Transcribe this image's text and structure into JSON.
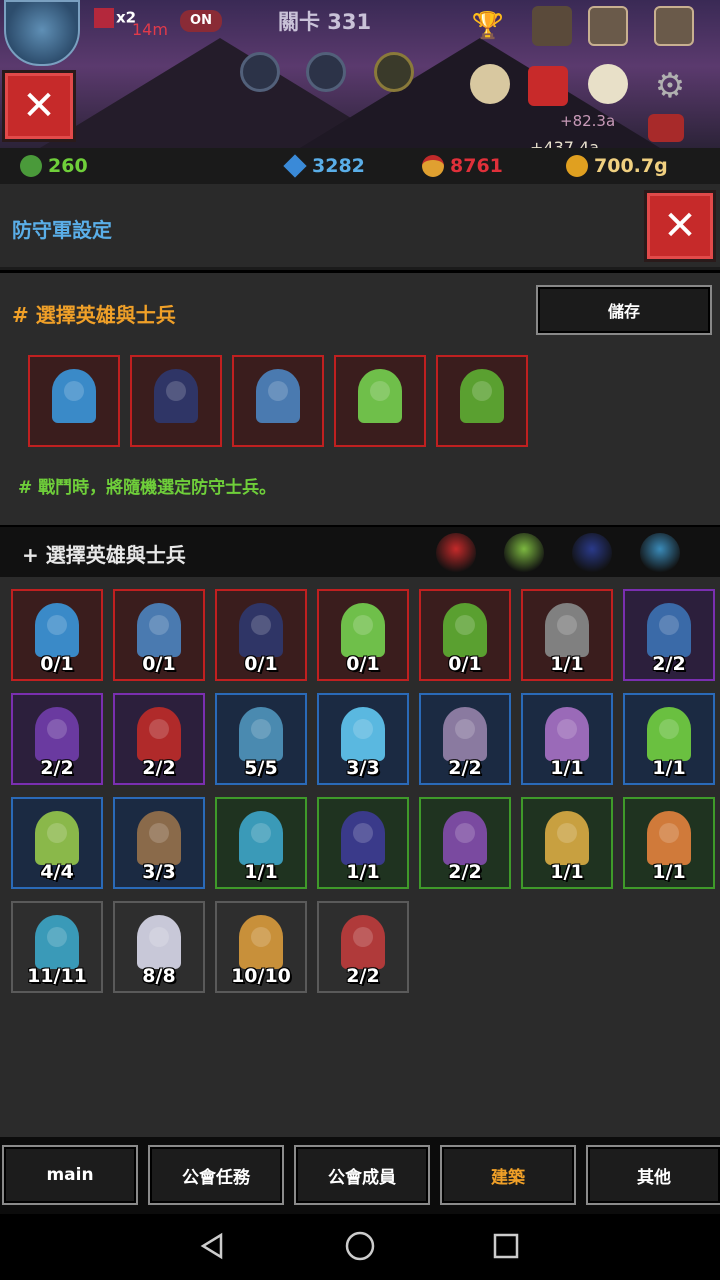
{
  "scene": {
    "speed_label": "x2",
    "timer": "14m",
    "toggle_label": "ON",
    "stage": "關卡 331",
    "floating_gain_1": "+82.3a",
    "floating_gain_2": "+437.4a"
  },
  "resources": {
    "gems_green": "260",
    "diamonds": "3282",
    "medals": "8761",
    "gold": "700.7g"
  },
  "panel": {
    "title": "防守軍設定",
    "selected_title": "# 選擇英雄與士兵",
    "save_label": "儲存",
    "hint": "# 戰鬥時，將隨機選定防守士兵。",
    "roster_title": "+ 選擇英雄與士兵"
  },
  "selected_units": [
    {
      "icon": "blue-dragon-rider-icon",
      "color": "#3a8ac8"
    },
    {
      "icon": "dark-knight-icon",
      "color": "#2f3566"
    },
    {
      "icon": "wolf-rider-icon",
      "color": "#4a7ab0"
    },
    {
      "icon": "forest-archer-icon",
      "color": "#6fbf4a"
    },
    {
      "icon": "fruit-tree-icon",
      "color": "#5aa030"
    }
  ],
  "filters": [
    {
      "icon": "red-hero-filter-icon",
      "color": "#c42a2a"
    },
    {
      "icon": "green-hero-filter-icon",
      "color": "#7cb840"
    },
    {
      "icon": "dark-hero-filter-icon",
      "color": "#2a3a8a"
    },
    {
      "icon": "blue-hero-filter-icon",
      "color": "#3a8ab8"
    }
  ],
  "roster": [
    {
      "count": "0/1",
      "tier": "red",
      "icon": "blue-dragon-rider-icon",
      "color": "#3a8ac8"
    },
    {
      "count": "0/1",
      "tier": "red",
      "icon": "wolf-rider-icon",
      "color": "#4a7ab0"
    },
    {
      "count": "0/1",
      "tier": "red",
      "icon": "dark-knight-icon",
      "color": "#2f3566"
    },
    {
      "count": "0/1",
      "tier": "red",
      "icon": "forest-archer-icon",
      "color": "#6fbf4a"
    },
    {
      "count": "0/1",
      "tier": "red",
      "icon": "fruit-tree-icon",
      "color": "#5aa030"
    },
    {
      "count": "1/1",
      "tier": "red",
      "icon": "stone-golem-icon",
      "color": "#808080"
    },
    {
      "count": "2/2",
      "tier": "purple",
      "icon": "blue-beast-icon",
      "color": "#3a6aa8"
    },
    {
      "count": "2/2",
      "tier": "purple",
      "icon": "hooded-mage-icon",
      "color": "#6a3aa0"
    },
    {
      "count": "2/2",
      "tier": "purple",
      "icon": "red-cavalry-icon",
      "color": "#b02a2a"
    },
    {
      "count": "5/5",
      "tier": "blue",
      "icon": "axe-warrior-icon",
      "color": "#4a8ab0"
    },
    {
      "count": "3/3",
      "tier": "blue",
      "icon": "ice-dragon-icon",
      "color": "#5ab8e0"
    },
    {
      "count": "2/2",
      "tier": "blue",
      "icon": "skeleton-flail-icon",
      "color": "#8a7aa0"
    },
    {
      "count": "1/1",
      "tier": "blue",
      "icon": "assassin-icon",
      "color": "#9a6ab8"
    },
    {
      "count": "1/1",
      "tier": "blue",
      "icon": "green-phoenix-icon",
      "color": "#6ac040"
    },
    {
      "count": "4/4",
      "tier": "blue",
      "icon": "elf-archer-icon",
      "color": "#8ab84a"
    },
    {
      "count": "3/3",
      "tier": "blue",
      "icon": "armored-soldier-icon",
      "color": "#8a6a4a"
    },
    {
      "count": "1/1",
      "tier": "green",
      "icon": "goblin-spearman-icon",
      "color": "#3a9ab8"
    },
    {
      "count": "1/1",
      "tier": "green",
      "icon": "shadow-wizard-icon",
      "color": "#3a3a8a"
    },
    {
      "count": "2/2",
      "tier": "green",
      "icon": "dark-hooded-icon",
      "color": "#7a4aa0"
    },
    {
      "count": "1/1",
      "tier": "green",
      "icon": "bandit-icon",
      "color": "#c8a040"
    },
    {
      "count": "1/1",
      "tier": "green",
      "icon": "fox-warrior-icon",
      "color": "#d07a3a"
    },
    {
      "count": "11/11",
      "tier": "gray",
      "icon": "goblin-icon",
      "color": "#3a9ab8"
    },
    {
      "count": "8/8",
      "tier": "gray",
      "icon": "skeleton-icon",
      "color": "#c8c8d8"
    },
    {
      "count": "10/10",
      "tier": "gray",
      "icon": "peasant-archer-icon",
      "color": "#c8903a"
    },
    {
      "count": "2/2",
      "tier": "gray",
      "icon": "red-swordsman-icon",
      "color": "#b03a3a"
    }
  ],
  "menu": [
    {
      "label": "main",
      "active": false
    },
    {
      "label": "公會任務",
      "active": false
    },
    {
      "label": "公會成員",
      "active": false
    },
    {
      "label": "建築",
      "active": true
    },
    {
      "label": "其他",
      "active": false
    }
  ],
  "colors": {
    "accent_orange": "#f0a028",
    "title_blue": "#5aaee8",
    "hint_green": "#6fcf3a",
    "medal_red": "#e0303a",
    "gold_yellow": "#f0d080"
  }
}
